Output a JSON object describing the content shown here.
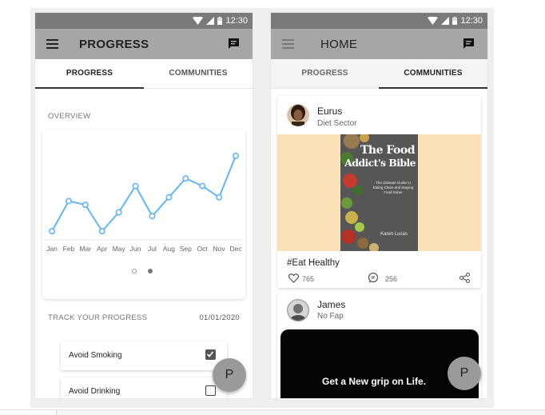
{
  "status_time": "12:30",
  "progress_screen": {
    "title": "PROGRESS",
    "tabs": [
      "PROGRESS",
      "COMMUNITIES"
    ],
    "active_tab": 0,
    "overview_label": "OVERVIEW",
    "chart_data": {
      "type": "line",
      "categories": [
        "Jan",
        "Feb",
        "Mar",
        "Apr",
        "May",
        "Jun",
        "Jul",
        "Aug",
        "Sep",
        "Oct",
        "Nov",
        "Dec"
      ],
      "values": [
        2,
        6,
        5.5,
        2,
        4.5,
        8,
        4,
        6.5,
        9,
        8,
        6.5,
        12
      ],
      "ylim": [
        0,
        14
      ],
      "color": "#64b5f6",
      "grid": false
    },
    "pager_dots": 2,
    "pager_active": 1,
    "track_label": "TRACK YOUR PROGRESS",
    "date": "01/01/2020",
    "habits": [
      {
        "label": "Avoid Smoking",
        "checked": true
      },
      {
        "label": "Avoid Drinking",
        "checked": false
      }
    ],
    "fab_label": "P"
  },
  "home_screen": {
    "title": "HOME",
    "tabs": [
      "PROGRESS",
      "COMMUNITIES"
    ],
    "active_tab": 1,
    "posts": [
      {
        "author": "Eurus",
        "subtitle": "Diet Sector",
        "book": {
          "title_line1": "The Food",
          "title_line2": "Addict's Bible",
          "tagline": "The Ultimate Guide to Eating Clean and Staying Food Sober",
          "author": "Karen Lucas"
        },
        "hashtag": "#Eat Healthy",
        "likes": "765",
        "comments": "256"
      },
      {
        "author": "James",
        "subtitle": "No Fap",
        "banner_text": "Get a New grip on Life."
      }
    ],
    "fab_label": "P"
  }
}
